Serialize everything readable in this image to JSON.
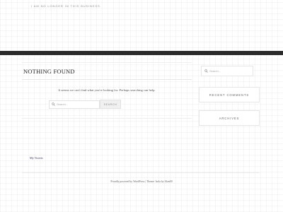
{
  "header": {
    "tagline": "I am no longer in this business."
  },
  "main": {
    "title": "NOTHING FOUND",
    "message": "It seems we can't find what you're looking for. Perhaps searching can help.",
    "search": {
      "placeholder": "Search...",
      "button_label": "SEARCH",
      "icon": "search-icon"
    }
  },
  "sidebar": {
    "search_placeholder": "Search...",
    "widgets": [
      {
        "title": "RECENT COMMENTS"
      },
      {
        "title": "ARCHIVES"
      }
    ]
  },
  "secondary": {
    "tweets_link": "My Tweets"
  },
  "footer": {
    "credit": "Proudly powered by WordPress | Theme: Isola by Alan00"
  },
  "colors": {
    "header_bar": "#2b2b2b",
    "background": "#ffffff",
    "border": "#e6e6e6"
  }
}
